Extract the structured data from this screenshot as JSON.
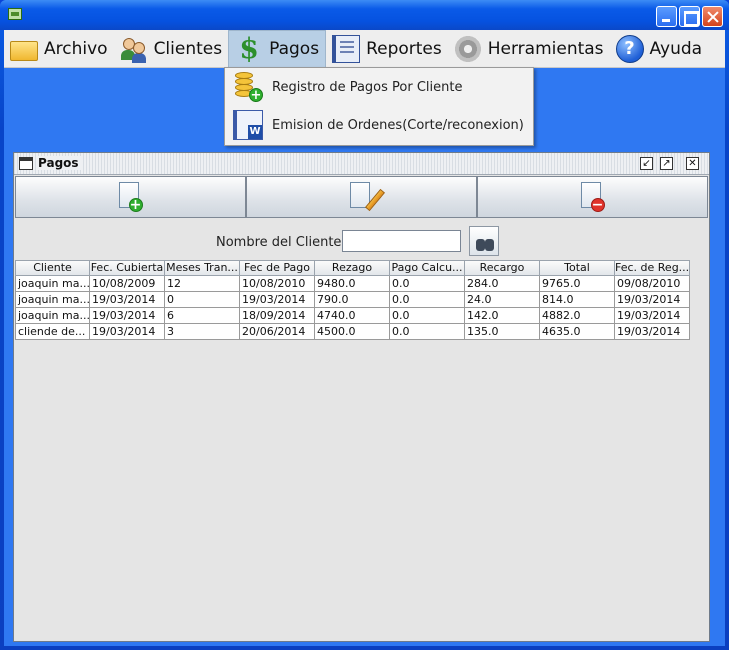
{
  "window": {
    "title": "",
    "colors": {
      "accent": "#0a5ae8",
      "client_bg": "#2f78f2"
    }
  },
  "menubar": {
    "items": [
      {
        "label": "Archivo",
        "icon": "folder-icon"
      },
      {
        "label": "Clientes",
        "icon": "users-icon"
      },
      {
        "label": "Pagos",
        "icon": "dollar-icon",
        "active": true
      },
      {
        "label": "Reportes",
        "icon": "report-icon"
      },
      {
        "label": "Herramientas",
        "icon": "gear-icon"
      },
      {
        "label": "Ayuda",
        "icon": "help-icon"
      }
    ]
  },
  "dropdown": {
    "items": [
      {
        "label": "Registro de Pagos Por Cliente",
        "icon": "coins-add-icon"
      },
      {
        "label": "Emision de Ordenes(Corte/reconexion)",
        "icon": "word-document-icon"
      }
    ]
  },
  "frame": {
    "title": "Pagos",
    "toolbar": {
      "add": "document-add-icon",
      "edit": "document-edit-icon",
      "delete": "document-delete-icon"
    },
    "search": {
      "label": "Nombre del Cliente:",
      "value": "",
      "placeholder": ""
    }
  },
  "table": {
    "columns": [
      "Cliente",
      "Fec. Cubierta",
      "Meses Tran...",
      "Fec de Pago",
      "Rezago",
      "Pago Calcu...",
      "Recargo",
      "Total",
      "Fec. de Reg..."
    ],
    "rows": [
      [
        "joaquin ma...",
        "10/08/2009",
        "12",
        "10/08/2010",
        "9480.0",
        "0.0",
        "284.0",
        "9765.0",
        "09/08/2010"
      ],
      [
        "joaquin ma...",
        "19/03/2014",
        "0",
        "19/03/2014",
        "790.0",
        "0.0",
        "24.0",
        "814.0",
        "19/03/2014"
      ],
      [
        "joaquin ma...",
        "19/03/2014",
        "6",
        "18/09/2014",
        "4740.0",
        "0.0",
        "142.0",
        "4882.0",
        "19/03/2014"
      ],
      [
        "cliende de...",
        "19/03/2014",
        "3",
        "20/06/2014",
        "4500.0",
        "0.0",
        "135.0",
        "4635.0",
        "19/03/2014"
      ]
    ]
  }
}
